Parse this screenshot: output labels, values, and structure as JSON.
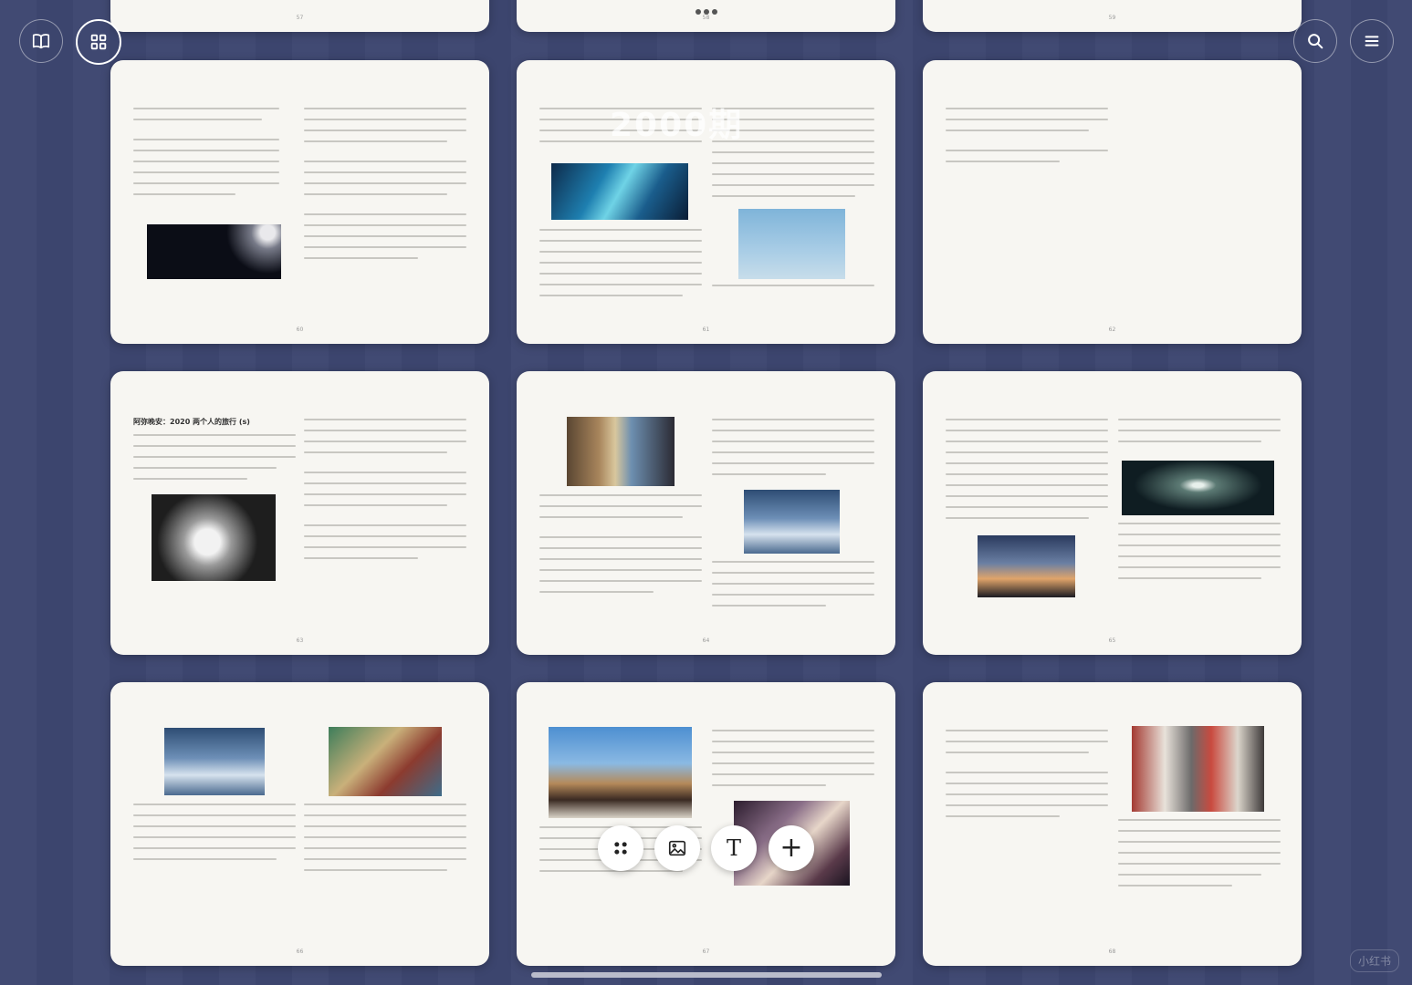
{
  "toolbar": {
    "left": [
      {
        "name": "book-icon"
      },
      {
        "name": "grid-icon",
        "active": true
      }
    ],
    "right": [
      {
        "name": "search-icon"
      },
      {
        "name": "menu-icon"
      }
    ]
  },
  "top_partial_pages": [
    "57",
    "58",
    "59"
  ],
  "overlay_title": "2000期",
  "pages": [
    {
      "num": "60"
    },
    {
      "num": "61"
    },
    {
      "num": "62"
    },
    {
      "num": "63",
      "heading": "阿弥晚安：2020 两个人的旅行 (s)"
    },
    {
      "num": "64"
    },
    {
      "num": "65"
    },
    {
      "num": "66"
    },
    {
      "num": "67"
    },
    {
      "num": "68"
    }
  ],
  "floating_toolbar": [
    {
      "name": "apps-icon"
    },
    {
      "name": "image-icon"
    },
    {
      "name": "text-icon",
      "glyph": "T"
    },
    {
      "name": "add-icon",
      "glyph": "+"
    }
  ],
  "watermark": "小红书"
}
